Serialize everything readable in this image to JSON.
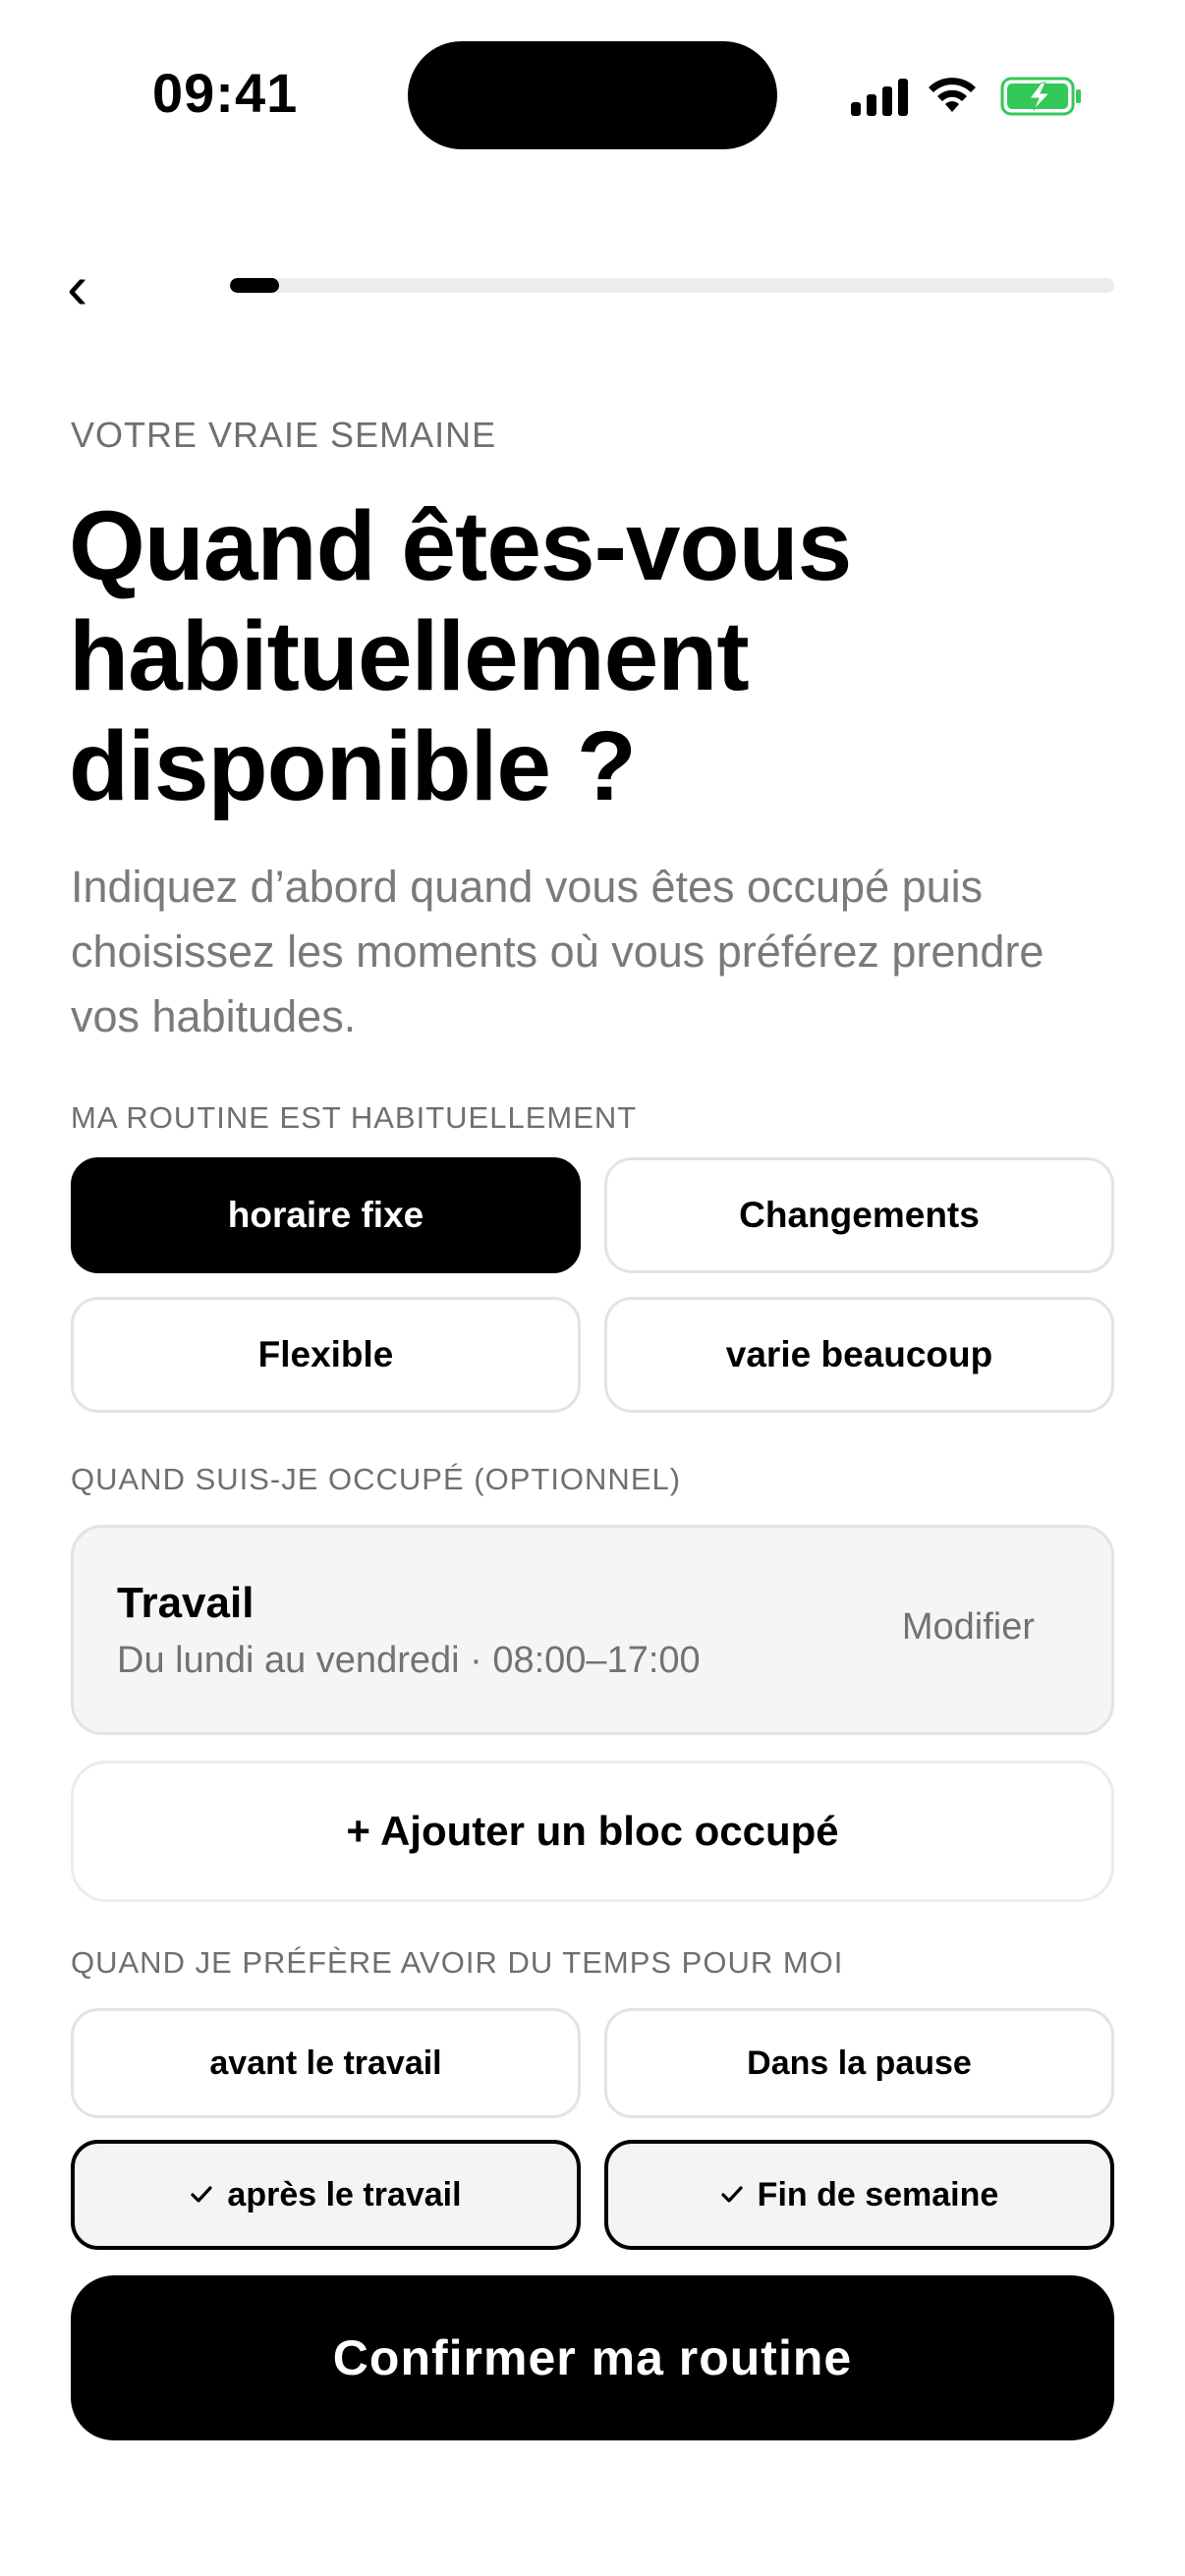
{
  "status_bar": {
    "time": "09:41"
  },
  "progress": {
    "value": 0.055
  },
  "header": {
    "eyebrow": "VOTRE VRAIE SEMAINE",
    "title": "Quand êtes-vous habituellement disponible ?",
    "subtitle": "Indiquez d’abord quand vous êtes occupé puis choisissez les moments où vous préférez prendre vos habitudes."
  },
  "routine": {
    "label": "MA ROUTINE EST HABITUELLEMENT",
    "options": [
      {
        "label": "horaire fixe",
        "selected": true
      },
      {
        "label": "Changements",
        "selected": false
      },
      {
        "label": "Flexible",
        "selected": false
      },
      {
        "label": "varie beaucoup",
        "selected": false
      }
    ]
  },
  "busy": {
    "label": "QUAND SUIS-JE OCCUPÉ (OPTIONNEL)",
    "blocks": [
      {
        "title": "Travail",
        "detail": "Du lundi au vendredi · 08:00–17:00",
        "edit_label": "Modifier"
      }
    ],
    "add_label": "+ Ajouter un bloc occupé"
  },
  "preferred": {
    "label": "QUAND JE PRÉFÈRE AVOIR DU TEMPS POUR MOI",
    "options": [
      {
        "label": "avant le travail",
        "checked": false
      },
      {
        "label": "Dans la pause",
        "checked": false
      },
      {
        "label": "après le travail",
        "checked": true
      },
      {
        "label": "Fin de semaine",
        "checked": true
      }
    ]
  },
  "confirm_label": "Confirmer ma routine",
  "colors": {
    "accent": "#000000",
    "battery": "#34c759"
  }
}
